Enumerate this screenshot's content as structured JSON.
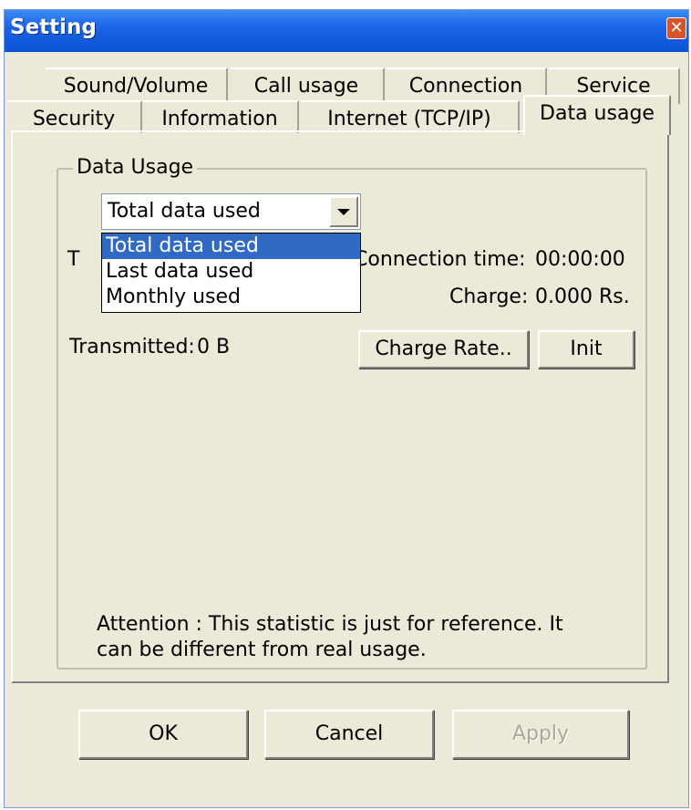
{
  "window": {
    "title": "Setting",
    "close_glyph": "✕"
  },
  "tabs": {
    "row1": [
      "Sound/Volume",
      "Call usage",
      "Connection",
      "Service"
    ],
    "row2": [
      "Security",
      "Information",
      "Internet (TCP/IP)",
      "Data usage"
    ],
    "active": "Data usage"
  },
  "data_usage": {
    "group_title": "Data Usage",
    "combo_value": "Total data used",
    "options": [
      "Total data used",
      "Last data used",
      "Monthly used"
    ],
    "selected_option": "Total data used",
    "hidden_label_fragment": "T",
    "connection_time_label": "Connection time:",
    "connection_time_value": "00:00:00",
    "charge_label": "Charge:",
    "charge_value": "0.000 Rs.",
    "transmitted_label": "Transmitted:",
    "transmitted_value": "0 B",
    "charge_rate_button": "Charge Rate..",
    "init_button": "Init",
    "attention_line1": "Attention : This statistic is just for reference. It",
    "attention_line2": "can be different from real usage."
  },
  "footer": {
    "ok": "OK",
    "cancel": "Cancel",
    "apply": "Apply",
    "apply_enabled": false
  }
}
